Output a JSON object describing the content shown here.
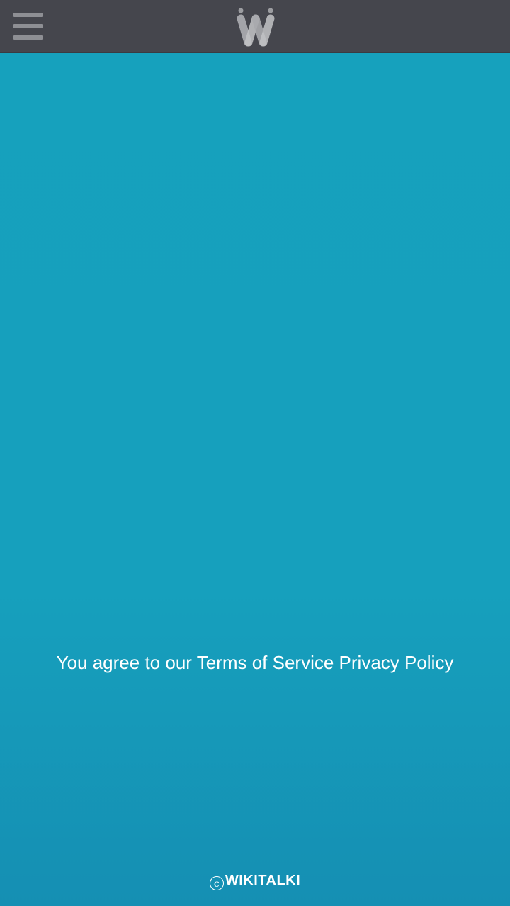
{
  "app": {
    "logo_icon": "wikitalki-w-logo",
    "menu_icon": "hamburger-menu-icon",
    "header_color": "#45464d",
    "background_color": "#16a1bd"
  },
  "agreement": {
    "prefix": "You agree to our",
    "terms_link": "Terms of Service",
    "privacy_link": "Privacy Policy"
  },
  "footer": {
    "copyright_symbol": "c",
    "brand": "WIKITALKI"
  }
}
